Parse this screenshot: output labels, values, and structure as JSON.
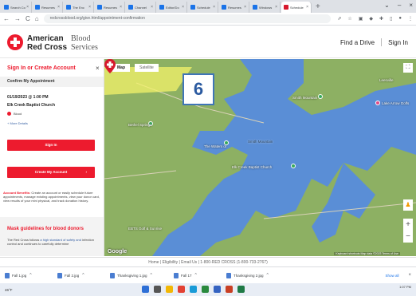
{
  "browser": {
    "tabs": [
      {
        "title": "Search Co"
      },
      {
        "title": "Resumes"
      },
      {
        "title": "The Enc"
      },
      {
        "title": "Resumes"
      },
      {
        "title": "Channel"
      },
      {
        "title": "Editor/Do"
      },
      {
        "title": "Schedule"
      },
      {
        "title": "Resumes"
      },
      {
        "title": "Windows"
      },
      {
        "title": "Schedule"
      }
    ],
    "active_tab_index": 9,
    "url": "redcrossblood.org/give.html/appointment-confirmation"
  },
  "site": {
    "logo_line1": "American",
    "logo_line2": "Red Cross",
    "logo_sub1": "Blood",
    "logo_sub2": "Services",
    "find_drive": "Find a Drive",
    "sign_in": "Sign In"
  },
  "panel": {
    "title": "Sign In or Create Account",
    "subtitle": "Confirm My Appointment",
    "date_time": "01/19/2023 @ 1:00 PM",
    "location": "Elk Creek Baptist Church",
    "donation_type": "Blood",
    "more_details": "+ More Details",
    "signin_label": "Sign In",
    "create_label": "Create My Account",
    "notice_title": "Account Benefits:",
    "notice_text": "Create an account or easily schedule future appointments, manage existing appointments, view your donor card, view results of your mini physical, and track donation history.",
    "mask_title": "Mask guidelines for blood donors",
    "mask_text_prefix": "The Red Cross follows",
    "mask_link": "a high standard of safety and",
    "mask_text_suffix": "infection control and continues to carefully determine"
  },
  "map": {
    "map_tab": "Map",
    "satellite_tab": "Satellite",
    "marker_number": "6",
    "labels": [
      "Leesville",
      "Smith Mountain",
      "Lake Arrow Golfs",
      "Bethel Springs",
      "The Waters of",
      "Smith Mountain",
      "Elk Creek Baptist Church",
      "EBTS Golf & Sunrise",
      "Google"
    ],
    "attribution": "Keyboard shortcuts  Map data ©2023  Terms of Use"
  },
  "footer": {
    "text": "Home  |  Eligibility  |  Email Us  |  1-800-RED CROSS (1-800-733-2767)"
  },
  "downloads": {
    "items": [
      "Fall 1.jpg",
      "Fall 2.jpg",
      "Thanksgiving 1.jpg",
      "Fall 17",
      "Thanksgiving 2.jpg"
    ],
    "show_all": "Show all"
  },
  "taskbar": {
    "weather": "46°F",
    "time": "1:07 PM"
  }
}
